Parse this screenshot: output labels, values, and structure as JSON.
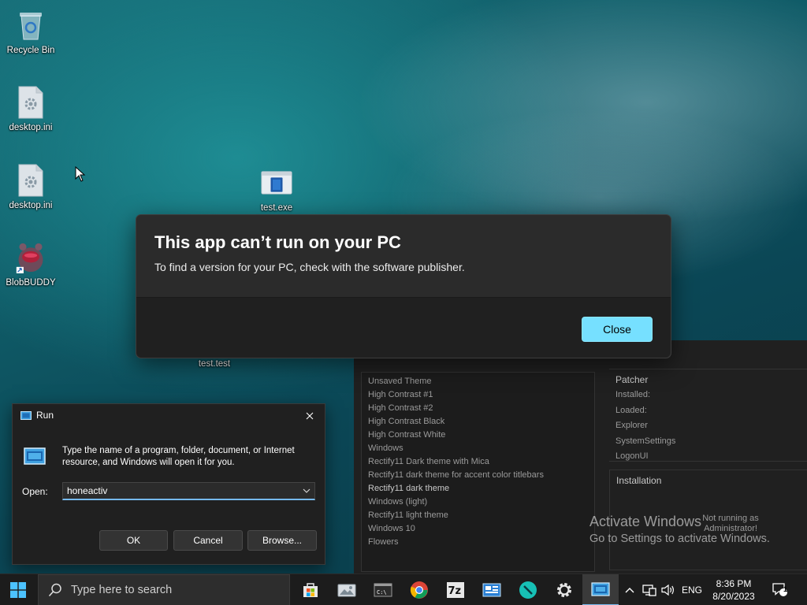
{
  "desktop": {
    "icons": [
      {
        "label": "Recycle Bin"
      },
      {
        "label": "desktop.ini"
      },
      {
        "label": "desktop.ini"
      },
      {
        "label": "BlobBUDDY"
      },
      {
        "label": "test.exe"
      },
      {
        "label": "test.test"
      }
    ]
  },
  "error_dialog": {
    "title": "This app can’t run on your PC",
    "message": "To find a version for your PC, check with the software publisher.",
    "close_label": "Close"
  },
  "patcher_app": {
    "themes": [
      "Unsaved Theme",
      "High Contrast #1",
      "High Contrast #2",
      "High Contrast Black",
      "High Contrast White",
      "Windows",
      "Rectify11 Dark theme with Mica",
      "Rectify11 dark theme for accent color titlebars",
      "Rectify11 dark theme",
      "Windows (light)",
      "Rectify11 light theme",
      "Windows 10",
      "Flowers"
    ],
    "patcher": {
      "header": "Patcher",
      "rows": [
        "Installed:",
        "Loaded:",
        "Explorer",
        "SystemSettings",
        "LogonUI"
      ]
    },
    "installation": {
      "header": "Installation",
      "status": "Not running as Administrator!"
    }
  },
  "watermark": {
    "line1": "Activate Windows",
    "line2": "Go to Settings to activate Windows."
  },
  "run_dialog": {
    "title": "Run",
    "description": "Type the name of a program, folder, document, or Internet resource, and Windows will open it for you.",
    "open_label": "Open:",
    "input_value": "honeactiv",
    "ok_label": "OK",
    "cancel_label": "Cancel",
    "browse_label": "Browse..."
  },
  "taskbar": {
    "search_placeholder": "Type here to search",
    "language": "ENG",
    "time": "8:36 PM",
    "date": "8/20/2023",
    "notification_count": "1"
  },
  "colors": {
    "accent": "#76e0ff",
    "dialog_bg": "#2b2b2b",
    "taskbar_bg": "#1c1c1c"
  }
}
